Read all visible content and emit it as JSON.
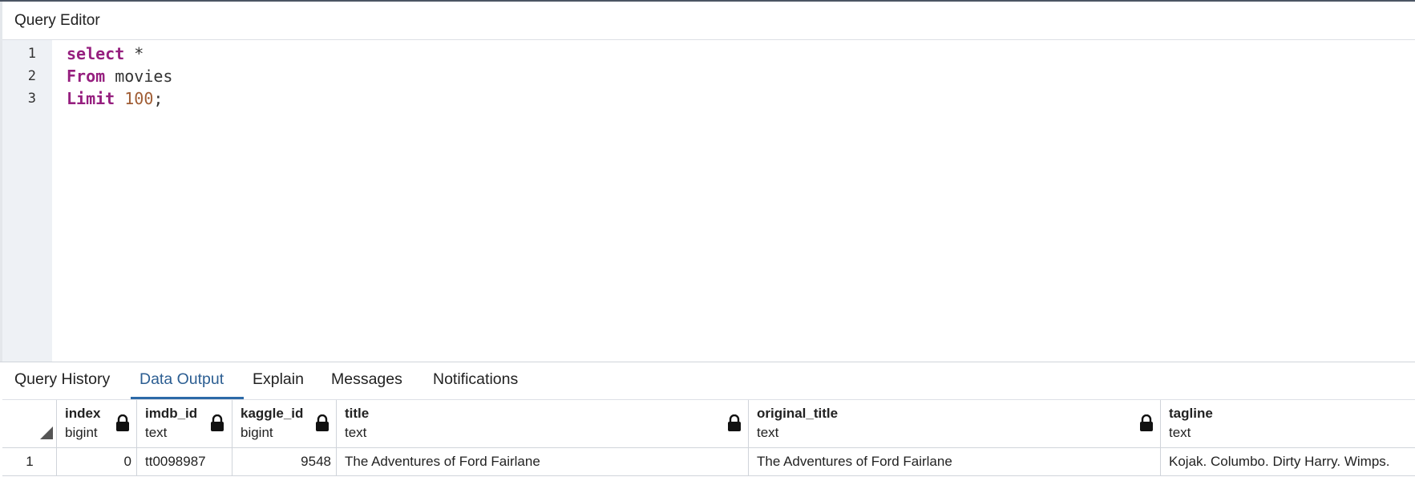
{
  "editor": {
    "title": "Query Editor",
    "lines": [
      {
        "num": "1",
        "parts": [
          {
            "t": "select",
            "c": "kw"
          },
          {
            "t": " *",
            "c": "plain"
          }
        ]
      },
      {
        "num": "2",
        "parts": [
          {
            "t": "From",
            "c": "kw"
          },
          {
            "t": " movies",
            "c": "plain"
          }
        ]
      },
      {
        "num": "3",
        "parts": [
          {
            "t": "Limit",
            "c": "kw"
          },
          {
            "t": " ",
            "c": "plain"
          },
          {
            "t": "100",
            "c": "num"
          },
          {
            "t": ";",
            "c": "plain"
          }
        ]
      }
    ]
  },
  "results": {
    "tabs": [
      "Query History",
      "Data Output",
      "Explain",
      "Messages",
      "Notifications"
    ],
    "active_tab": "Data Output",
    "columns": [
      {
        "name": "index",
        "type": "bigint"
      },
      {
        "name": "imdb_id",
        "type": "text"
      },
      {
        "name": "kaggle_id",
        "type": "bigint"
      },
      {
        "name": "title",
        "type": "text"
      },
      {
        "name": "original_title",
        "type": "text"
      },
      {
        "name": "tagline",
        "type": "text"
      }
    ],
    "rows": [
      {
        "row_num": "1",
        "cells": [
          "0",
          "tt0098987",
          "9548",
          "The Adventures of Ford Fairlane",
          "The Adventures of Ford Fairlane",
          "Kojak. Columbo. Dirty Harry. Wimps."
        ]
      }
    ]
  }
}
